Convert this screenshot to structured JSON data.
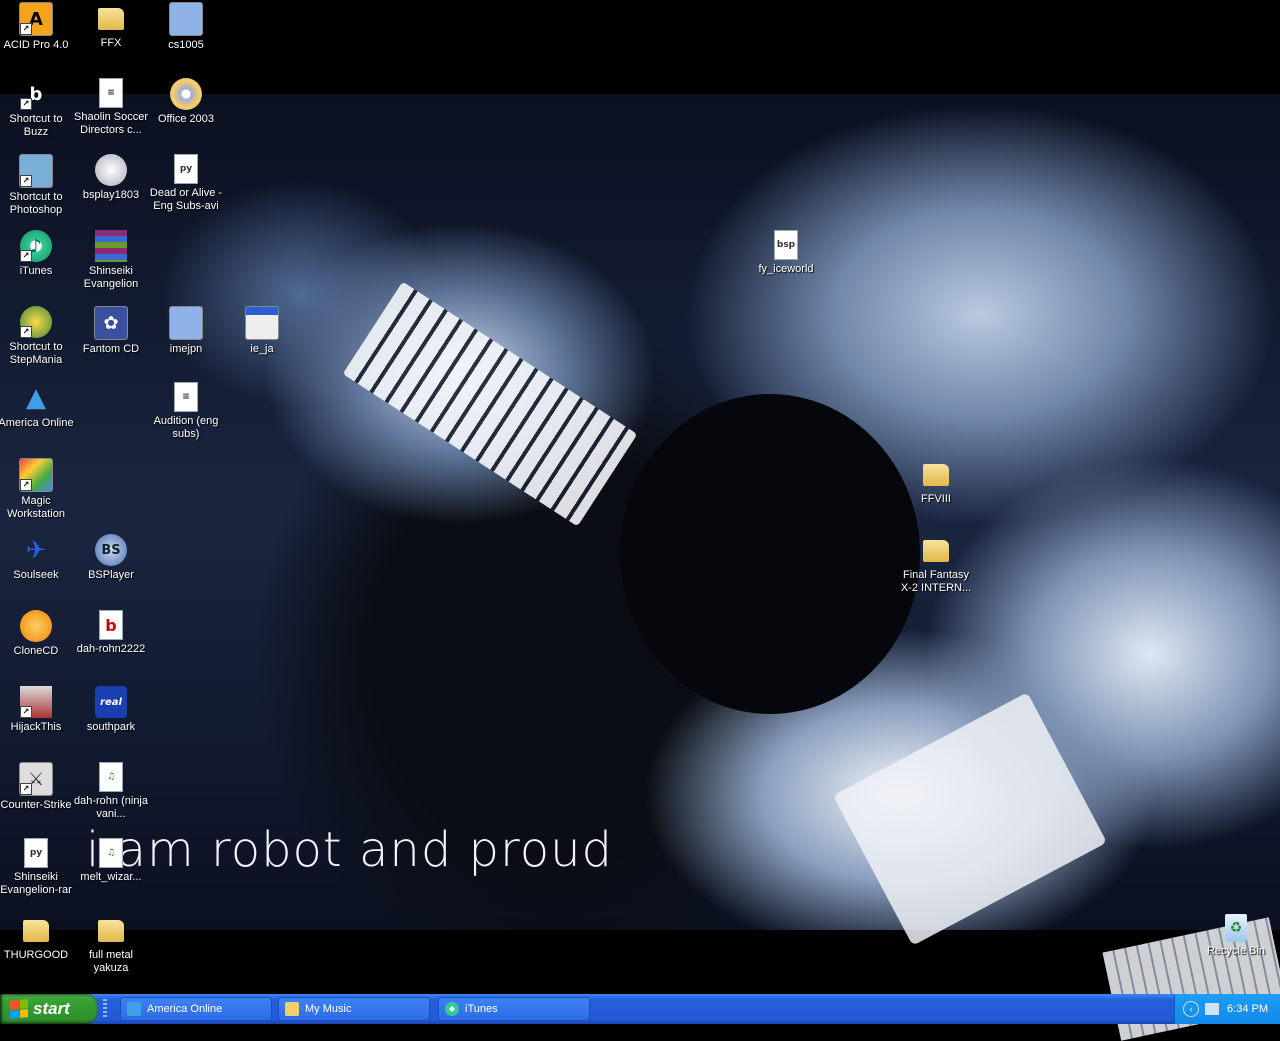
{
  "wallpaper": {
    "caption": "i am robot and proud"
  },
  "desktop": {
    "icons": [
      {
        "label": "ACID Pro 4.0",
        "icon": "acid-icon",
        "shortcut": true
      },
      {
        "label": "FFX",
        "icon": "folder-icon"
      },
      {
        "label": "cs1005",
        "icon": "setup-icon"
      },
      {
        "label": "Shortcut to Buzz",
        "icon": "buzz-icon",
        "shortcut": true
      },
      {
        "label": "Shaolin Soccer Directors c...",
        "icon": "text-file-icon"
      },
      {
        "label": "Office 2003",
        "icon": "cd-icon"
      },
      {
        "label": "Shortcut to Photoshop",
        "icon": "photoshop-icon",
        "shortcut": true
      },
      {
        "label": "bsplay1803",
        "icon": "installer-icon"
      },
      {
        "label": "Dead or Alive - Eng Subs-avi",
        "icon": "py-file-icon"
      },
      {
        "label": "iTunes",
        "icon": "itunes-icon",
        "shortcut": true
      },
      {
        "label": "Shinseiki Evangelion",
        "icon": "winrar-icon"
      },
      {
        "label": "fy_iceworld",
        "icon": "map-file-icon"
      },
      {
        "label": "Shortcut to StepMania",
        "icon": "stepmania-icon",
        "shortcut": true
      },
      {
        "label": "Fantom CD",
        "icon": "fantom-cd-icon"
      },
      {
        "label": "imejpn",
        "icon": "setup-icon"
      },
      {
        "label": "ie_ja",
        "icon": "window-app-icon"
      },
      {
        "label": "America Online",
        "icon": "aol-icon"
      },
      {
        "label": "Audition (eng subs)",
        "icon": "text-file-icon"
      },
      {
        "label": "Magic Workstation",
        "icon": "magic-icon",
        "shortcut": true
      },
      {
        "label": "FFVIII",
        "icon": "folder-icon"
      },
      {
        "label": "Soulseek",
        "icon": "soulseek-icon"
      },
      {
        "label": "BSPlayer",
        "icon": "bsplayer-icon"
      },
      {
        "label": "Final Fantasy X-2 INTERN...",
        "icon": "folder-icon"
      },
      {
        "label": "CloneCD",
        "icon": "clonecd-icon"
      },
      {
        "label": "dah-rohn2222",
        "icon": "b-file-icon"
      },
      {
        "label": "HijackThis",
        "icon": "hijackthis-icon",
        "shortcut": true
      },
      {
        "label": "southpark",
        "icon": "real-icon"
      },
      {
        "label": "Counter-Strike",
        "icon": "counter-strike-icon",
        "shortcut": true
      },
      {
        "label": "dah-rohn (ninja vani...",
        "icon": "mp3-file-icon"
      },
      {
        "label": "Shinseiki Evangelion-rar",
        "icon": "py-file-icon"
      },
      {
        "label": "melt_wizar...",
        "icon": "mp3-file-icon"
      },
      {
        "label": "THURGOOD",
        "icon": "folder-icon"
      },
      {
        "label": "full metal yakuza",
        "icon": "folder-icon"
      },
      {
        "label": "Recycle Bin",
        "icon": "recycle-bin-icon"
      }
    ]
  },
  "taskbar": {
    "start_label": "start",
    "buttons": [
      {
        "label": "America  Online",
        "icon": "aol-icon"
      },
      {
        "label": "My Music",
        "icon": "folder-icon"
      },
      {
        "label": "iTunes",
        "icon": "itunes-icon"
      }
    ],
    "clock": "6:34 PM"
  },
  "colors": {
    "taskbar_blue": "#245edb",
    "start_green": "#36a033",
    "tray_blue": "#1287e8"
  }
}
